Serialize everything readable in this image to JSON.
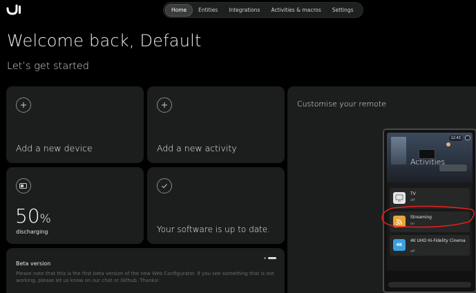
{
  "nav": {
    "tabs": [
      {
        "label": "Home",
        "active": true
      },
      {
        "label": "Entities"
      },
      {
        "label": "Integrations"
      },
      {
        "label": "Activities & macros"
      },
      {
        "label": "Settings"
      }
    ]
  },
  "welcome": "Welcome back, Default",
  "subtitle": "Let’s get started",
  "cards": {
    "add_device": "Add a new device",
    "add_activity": "Add a new activity",
    "battery": {
      "value": "50",
      "unit": "%",
      "status": "discharging"
    },
    "software": "Your software is up to date.",
    "beta": {
      "title": "Beta version",
      "text": "Please note that this is the first beta version of the new Web Configurator. If you see something that is not working, please let us know on our chat or Github. Thanks!"
    }
  },
  "customise": {
    "title": "Customise your remote",
    "remote": {
      "time": "12:43",
      "title": "Activities",
      "items": [
        {
          "name": "TV",
          "state": "off",
          "icon": "tv-icon"
        },
        {
          "name": "Streaming",
          "state": "on",
          "icon": "streaming-icon"
        },
        {
          "name": "4K UHD Hi-Fidelity Cinema",
          "state": "off",
          "icon": "4k-icon",
          "icon_text": "4K"
        }
      ]
    }
  },
  "colors": {
    "background": "#000000",
    "card": "#1c1d1d",
    "annotation": "#e02020",
    "streaming_icon": "#e8a53a",
    "cinema_icon": "#3aa0e0"
  }
}
